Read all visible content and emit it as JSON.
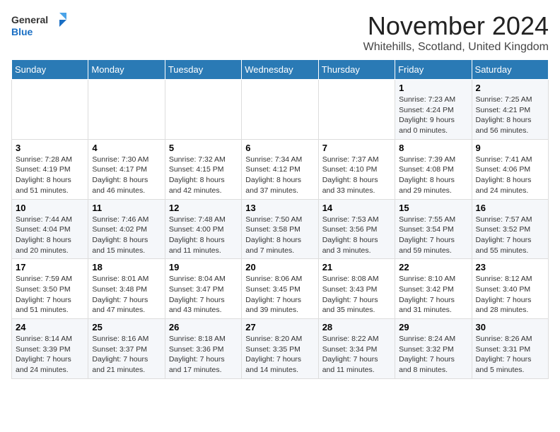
{
  "logo": {
    "text_general": "General",
    "text_blue": "Blue"
  },
  "title": "November 2024",
  "location": "Whitehills, Scotland, United Kingdom",
  "days_of_week": [
    "Sunday",
    "Monday",
    "Tuesday",
    "Wednesday",
    "Thursday",
    "Friday",
    "Saturday"
  ],
  "weeks": [
    [
      {
        "day": "",
        "info": ""
      },
      {
        "day": "",
        "info": ""
      },
      {
        "day": "",
        "info": ""
      },
      {
        "day": "",
        "info": ""
      },
      {
        "day": "",
        "info": ""
      },
      {
        "day": "1",
        "info": "Sunrise: 7:23 AM\nSunset: 4:24 PM\nDaylight: 9 hours and 0 minutes."
      },
      {
        "day": "2",
        "info": "Sunrise: 7:25 AM\nSunset: 4:21 PM\nDaylight: 8 hours and 56 minutes."
      }
    ],
    [
      {
        "day": "3",
        "info": "Sunrise: 7:28 AM\nSunset: 4:19 PM\nDaylight: 8 hours and 51 minutes."
      },
      {
        "day": "4",
        "info": "Sunrise: 7:30 AM\nSunset: 4:17 PM\nDaylight: 8 hours and 46 minutes."
      },
      {
        "day": "5",
        "info": "Sunrise: 7:32 AM\nSunset: 4:15 PM\nDaylight: 8 hours and 42 minutes."
      },
      {
        "day": "6",
        "info": "Sunrise: 7:34 AM\nSunset: 4:12 PM\nDaylight: 8 hours and 37 minutes."
      },
      {
        "day": "7",
        "info": "Sunrise: 7:37 AM\nSunset: 4:10 PM\nDaylight: 8 hours and 33 minutes."
      },
      {
        "day": "8",
        "info": "Sunrise: 7:39 AM\nSunset: 4:08 PM\nDaylight: 8 hours and 29 minutes."
      },
      {
        "day": "9",
        "info": "Sunrise: 7:41 AM\nSunset: 4:06 PM\nDaylight: 8 hours and 24 minutes."
      }
    ],
    [
      {
        "day": "10",
        "info": "Sunrise: 7:44 AM\nSunset: 4:04 PM\nDaylight: 8 hours and 20 minutes."
      },
      {
        "day": "11",
        "info": "Sunrise: 7:46 AM\nSunset: 4:02 PM\nDaylight: 8 hours and 15 minutes."
      },
      {
        "day": "12",
        "info": "Sunrise: 7:48 AM\nSunset: 4:00 PM\nDaylight: 8 hours and 11 minutes."
      },
      {
        "day": "13",
        "info": "Sunrise: 7:50 AM\nSunset: 3:58 PM\nDaylight: 8 hours and 7 minutes."
      },
      {
        "day": "14",
        "info": "Sunrise: 7:53 AM\nSunset: 3:56 PM\nDaylight: 8 hours and 3 minutes."
      },
      {
        "day": "15",
        "info": "Sunrise: 7:55 AM\nSunset: 3:54 PM\nDaylight: 7 hours and 59 minutes."
      },
      {
        "day": "16",
        "info": "Sunrise: 7:57 AM\nSunset: 3:52 PM\nDaylight: 7 hours and 55 minutes."
      }
    ],
    [
      {
        "day": "17",
        "info": "Sunrise: 7:59 AM\nSunset: 3:50 PM\nDaylight: 7 hours and 51 minutes."
      },
      {
        "day": "18",
        "info": "Sunrise: 8:01 AM\nSunset: 3:48 PM\nDaylight: 7 hours and 47 minutes."
      },
      {
        "day": "19",
        "info": "Sunrise: 8:04 AM\nSunset: 3:47 PM\nDaylight: 7 hours and 43 minutes."
      },
      {
        "day": "20",
        "info": "Sunrise: 8:06 AM\nSunset: 3:45 PM\nDaylight: 7 hours and 39 minutes."
      },
      {
        "day": "21",
        "info": "Sunrise: 8:08 AM\nSunset: 3:43 PM\nDaylight: 7 hours and 35 minutes."
      },
      {
        "day": "22",
        "info": "Sunrise: 8:10 AM\nSunset: 3:42 PM\nDaylight: 7 hours and 31 minutes."
      },
      {
        "day": "23",
        "info": "Sunrise: 8:12 AM\nSunset: 3:40 PM\nDaylight: 7 hours and 28 minutes."
      }
    ],
    [
      {
        "day": "24",
        "info": "Sunrise: 8:14 AM\nSunset: 3:39 PM\nDaylight: 7 hours and 24 minutes."
      },
      {
        "day": "25",
        "info": "Sunrise: 8:16 AM\nSunset: 3:37 PM\nDaylight: 7 hours and 21 minutes."
      },
      {
        "day": "26",
        "info": "Sunrise: 8:18 AM\nSunset: 3:36 PM\nDaylight: 7 hours and 17 minutes."
      },
      {
        "day": "27",
        "info": "Sunrise: 8:20 AM\nSunset: 3:35 PM\nDaylight: 7 hours and 14 minutes."
      },
      {
        "day": "28",
        "info": "Sunrise: 8:22 AM\nSunset: 3:34 PM\nDaylight: 7 hours and 11 minutes."
      },
      {
        "day": "29",
        "info": "Sunrise: 8:24 AM\nSunset: 3:32 PM\nDaylight: 7 hours and 8 minutes."
      },
      {
        "day": "30",
        "info": "Sunrise: 8:26 AM\nSunset: 3:31 PM\nDaylight: 7 hours and 5 minutes."
      }
    ]
  ]
}
